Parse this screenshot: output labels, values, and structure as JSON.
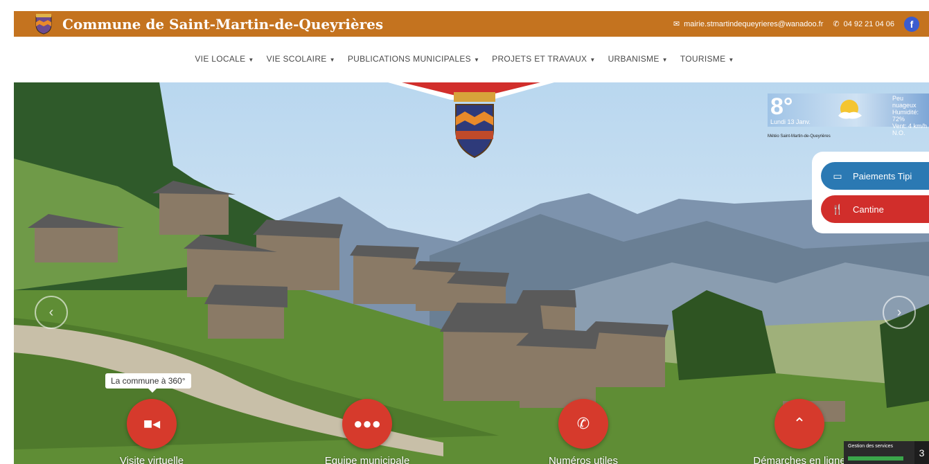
{
  "header": {
    "site_title": "Commune de Saint-Martin-de-Queyrières",
    "email": "mairie.stmartindequeyrieres@wanadoo.fr",
    "phone": "04 92 21 04 06",
    "facebook_icon": "f"
  },
  "nav": {
    "items": [
      {
        "label": "VIE LOCALE"
      },
      {
        "label": "VIE SCOLAIRE"
      },
      {
        "label": "PUBLICATIONS MUNICIPALES"
      },
      {
        "label": "PROJETS ET TRAVAUX"
      },
      {
        "label": "URBANISME"
      },
      {
        "label": "TOURISME"
      }
    ]
  },
  "weather": {
    "temperature": "8°",
    "date": "Lundi 13 Janv.",
    "desc_line1": "Peu nuageux",
    "desc_line2": "Humidité: 72%",
    "desc_line3": "Vent: 4 km/h",
    "desc_line4": "N.O.",
    "caption": "Météo Saint-Martin-de-Queyrières"
  },
  "quick_links": {
    "tipi": "Paiements Tipi",
    "cantine": "Cantine"
  },
  "tooltip": "La commune à 360°",
  "features": [
    {
      "label": "Visite virtuelle",
      "icon": "video-camera-icon"
    },
    {
      "label": "Equipe municipale",
      "icon": "group-icon"
    },
    {
      "label": "Numéros utiles",
      "icon": "phone-icon"
    },
    {
      "label": "Démarches en ligne",
      "icon": "chevron-up-icon"
    }
  ],
  "services": {
    "label": "Gestion des services",
    "tab": "3"
  },
  "colors": {
    "topbar": "#c4731f",
    "feature_red": "#d63a2c",
    "tipi_blue": "#2b79b3",
    "cantine_red": "#d12e2b"
  }
}
